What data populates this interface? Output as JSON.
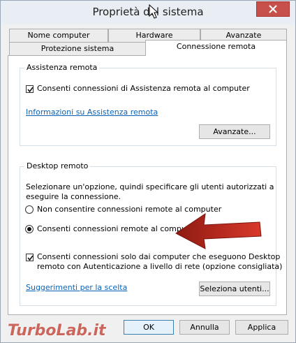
{
  "window": {
    "title": "Proprietà del sistema"
  },
  "tabs_row1": [
    "Nome computer",
    "Hardware",
    "Avanzate"
  ],
  "tabs_row2": [
    "Protezione sistema",
    "Connessione remota"
  ],
  "assistenza": {
    "group_label": "Assistenza remota",
    "checkbox_label": "Consenti connessioni di Assistenza remota al computer",
    "checked": true,
    "info_link": "Informazioni su Assistenza remota",
    "advanced_button": "Avanzate..."
  },
  "desktop": {
    "group_label": "Desktop remoto",
    "instructions_line1": "Selezionare un'opzione, quindi specificare gli utenti autorizzati a",
    "instructions_line2": "eseguire la connessione.",
    "radio_no": "Non consentire connessioni remote al computer",
    "radio_yes": "Consenti connessioni remote al computer",
    "selected": "radio_yes",
    "nla_line1": "Consenti connessioni solo dai computer che eseguono Desktop",
    "nla_line2": "remoto con Autenticazione a livello di rete (opzione consigliata)",
    "nla_checked": true,
    "suggest_link": "Suggerimenti per la scelta",
    "select_users_button": "Seleziona utenti..."
  },
  "footer": {
    "ok": "OK",
    "cancel": "Annulla",
    "apply": "Applica"
  },
  "watermark": "TurboLab.it",
  "colors": {
    "arrow": "#c0392b",
    "link": "#0b62b5",
    "close": "#c7504b"
  }
}
